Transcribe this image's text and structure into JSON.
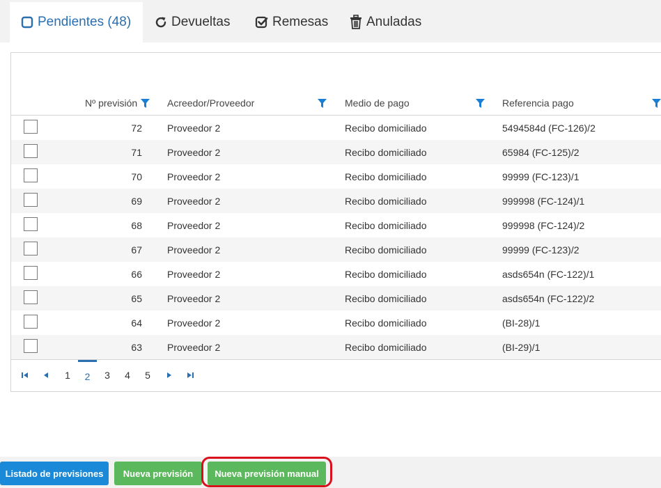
{
  "tabs": [
    {
      "label": "Pendientes (48)",
      "icon": "square-outline-icon",
      "active": true
    },
    {
      "label": "Devueltas",
      "icon": "refresh-icon",
      "active": false
    },
    {
      "label": "Remesas",
      "icon": "check-square-icon",
      "active": false
    },
    {
      "label": "Anuladas",
      "icon": "trash-icon",
      "active": false
    }
  ],
  "grid": {
    "columns": {
      "num": "Nº previsión",
      "acreedor": "Acreedor/Proveedor",
      "medio": "Medio de pago",
      "referencia": "Referencia pago"
    },
    "rows": [
      {
        "num": "72",
        "acreedor": "Proveedor 2",
        "medio": "Recibo domiciliado",
        "referencia": "5494584d (FC-126)/2"
      },
      {
        "num": "71",
        "acreedor": "Proveedor 2",
        "medio": "Recibo domiciliado",
        "referencia": "65984 (FC-125)/2"
      },
      {
        "num": "70",
        "acreedor": "Proveedor 2",
        "medio": "Recibo domiciliado",
        "referencia": "99999 (FC-123)/1"
      },
      {
        "num": "69",
        "acreedor": "Proveedor 2",
        "medio": "Recibo domiciliado",
        "referencia": "999998 (FC-124)/1"
      },
      {
        "num": "68",
        "acreedor": "Proveedor 2",
        "medio": "Recibo domiciliado",
        "referencia": "999998 (FC-124)/2"
      },
      {
        "num": "67",
        "acreedor": "Proveedor 2",
        "medio": "Recibo domiciliado",
        "referencia": "99999 (FC-123)/2"
      },
      {
        "num": "66",
        "acreedor": "Proveedor 2",
        "medio": "Recibo domiciliado",
        "referencia": "asds654n (FC-122)/1"
      },
      {
        "num": "65",
        "acreedor": "Proveedor 2",
        "medio": "Recibo domiciliado",
        "referencia": "asds654n (FC-122)/2"
      },
      {
        "num": "64",
        "acreedor": "Proveedor 2",
        "medio": "Recibo domiciliado",
        "referencia": "(BI-28)/1"
      },
      {
        "num": "63",
        "acreedor": "Proveedor 2",
        "medio": "Recibo domiciliado",
        "referencia": "(BI-29)/1"
      }
    ]
  },
  "pager": {
    "pages": [
      "1",
      "2",
      "3",
      "4",
      "5"
    ],
    "current": "2"
  },
  "footer": {
    "listado_label": "Listado de previsiones",
    "nueva_label": "Nueva previsión",
    "manual_label": "Nueva previsión manual"
  },
  "colors": {
    "accent_blue": "#2a6fb0",
    "filter_blue": "#1a7fd4",
    "button_blue": "#1a8ad8",
    "button_green": "#5cb85c",
    "highlight_red": "#d9101c"
  }
}
